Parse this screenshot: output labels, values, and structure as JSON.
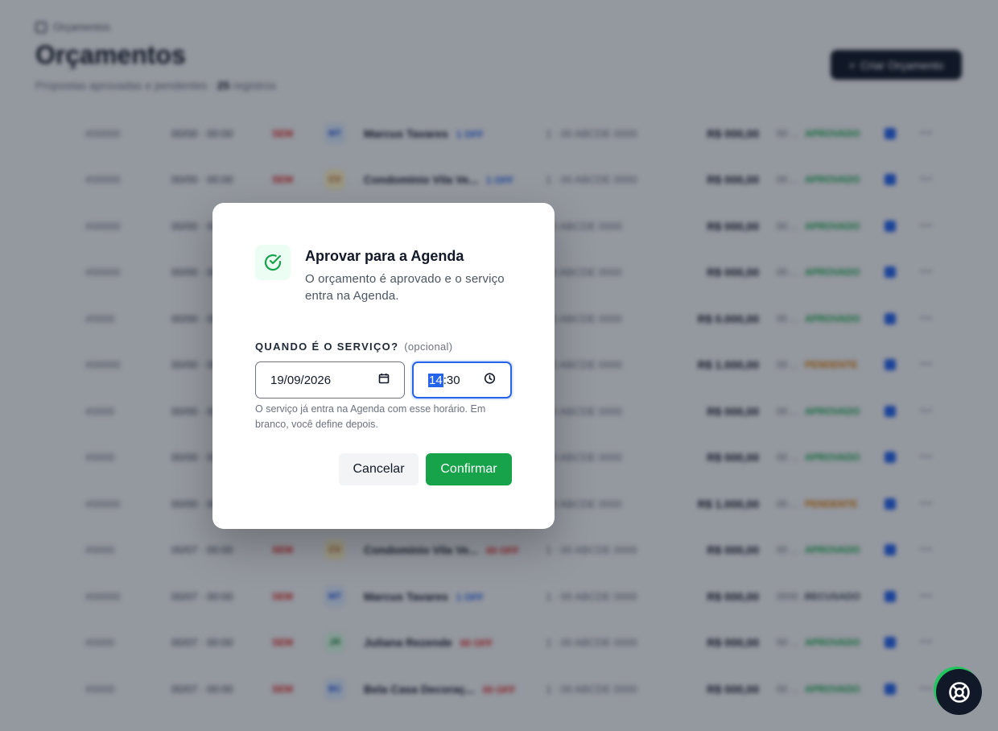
{
  "background": {
    "breadcrumb": "Orçamentos",
    "title": "Orçamentos",
    "subtitle": "Propostas aprovadas e pendentes",
    "subtitle_count": "25",
    "subtitle_suffix": "registros",
    "new_button": "Criar Orçamento"
  },
  "rows": [
    {
      "num": "#00000",
      "date": "00/00 · 00:00",
      "tag": "SEM",
      "av": "MT",
      "av_color": "#dbeafe",
      "av_text": "#1d4ed8",
      "client": "Marcus Tavares",
      "pill": "1 OFF",
      "pill_color": "#2563eb",
      "serv": "1 · 00 ABCDE 0000",
      "val": "R$ 000,00",
      "mini": "00 ...",
      "status": "APROVADO",
      "status_color": "#16a34a"
    },
    {
      "num": "#00000",
      "date": "00/00 · 00:00",
      "tag": "SEM",
      "av": "CV",
      "av_color": "#fef3c7",
      "av_text": "#b45309",
      "client": "Condomínio Vila Ve...",
      "pill": "1 OFF",
      "pill_color": "#2563eb",
      "serv": "1 · 00 ABCDE 0000",
      "val": "R$ 000,00",
      "mini": "00 ...",
      "status": "APROVADO",
      "status_color": "#16a34a"
    },
    {
      "num": "#00000",
      "date": "00/00 · 00:00",
      "tag": "",
      "av": "",
      "av_color": "transparent",
      "av_text": "#000",
      "client": "",
      "pill": "",
      "pill_color": "#000",
      "serv": "00 ABCDE 0000",
      "val": "R$ 000,00",
      "mini": "00 ...",
      "status": "APROVADO",
      "status_color": "#16a34a"
    },
    {
      "num": "#00000",
      "date": "00/00 · 00:00",
      "tag": "",
      "av": "",
      "av_color": "transparent",
      "av_text": "#000",
      "client": "",
      "pill": "",
      "pill_color": "#000",
      "serv": "00 ABCDE 0000",
      "val": "R$ 000,00",
      "mini": "00 ...",
      "status": "APROVADO",
      "status_color": "#16a34a"
    },
    {
      "num": "#0000",
      "date": "00/00 · 00:00",
      "tag": "",
      "av": "",
      "av_color": "transparent",
      "av_text": "#000",
      "client": "",
      "pill": "",
      "pill_color": "#000",
      "serv": "00 ABCDE 0000",
      "val": "R$ 0.000,00",
      "mini": "00 ...",
      "status": "APROVADO",
      "status_color": "#16a34a"
    },
    {
      "num": "#00000",
      "date": "00/00 · 00:00",
      "tag": "",
      "av": "",
      "av_color": "transparent",
      "av_text": "#000",
      "client": "",
      "pill": "",
      "pill_color": "#000",
      "serv": "00 ABCDE 0000",
      "val": "R$ 1.000,00",
      "mini": "00 ...",
      "status": "PENDENTE",
      "status_color": "#d97706"
    },
    {
      "num": "#0000",
      "date": "00/00 · 00:00",
      "tag": "",
      "av": "",
      "av_color": "transparent",
      "av_text": "#000",
      "client": "",
      "pill": "",
      "pill_color": "#000",
      "serv": "00 ABCDE 0000",
      "val": "R$ 000,00",
      "mini": "00 ...",
      "status": "APROVADO",
      "status_color": "#16a34a"
    },
    {
      "num": "#0000",
      "date": "00/00 · 00:00",
      "tag": "",
      "av": "",
      "av_color": "transparent",
      "av_text": "#000",
      "client": "",
      "pill": "",
      "pill_color": "#000",
      "serv": "00 ABCDE 0000",
      "val": "R$ 000,00",
      "mini": "00 ...",
      "status": "APROVADO",
      "status_color": "#16a34a"
    },
    {
      "num": "#00000",
      "date": "00/00 · 00:00",
      "tag": "",
      "av": "",
      "av_color": "transparent",
      "av_text": "#000",
      "client": "",
      "pill": "",
      "pill_color": "#000",
      "serv": "00 ABCDE 0000",
      "val": "R$ 1.000,00",
      "mini": "00 ...",
      "status": "PENDENTE",
      "status_color": "#d97706"
    },
    {
      "num": "#0000",
      "date": "00/07 · 00:00",
      "tag": "SEM",
      "av": "CV",
      "av_color": "#fef3c7",
      "av_text": "#b45309",
      "client": "Condomínio Vila Ve...",
      "pill": "00 OFF",
      "pill_color": "#dc2626",
      "serv": "1 · 00 ABCDE 0000",
      "val": "R$ 000,00",
      "mini": "00 ...",
      "status": "APROVADO",
      "status_color": "#16a34a"
    },
    {
      "num": "#00000",
      "date": "00/07 · 00:00",
      "tag": "SEM",
      "av": "MT",
      "av_color": "#dbeafe",
      "av_text": "#1d4ed8",
      "client": "Marcus Tavares",
      "pill": "1 OFF",
      "pill_color": "#2563eb",
      "serv": "1 · 00 ABCDE 0000",
      "val": "R$ 000,00",
      "mini": "0000 ...",
      "status": "RECUSADO",
      "status_color": "#374151"
    },
    {
      "num": "#0000",
      "date": "00/07 · 00:00",
      "tag": "SEM",
      "av": "JR",
      "av_color": "#dcfce7",
      "av_text": "#15803d",
      "client": "Juliana Rezende",
      "pill": "00 OFF",
      "pill_color": "#dc2626",
      "serv": "1 · 00 ABCDE 0000",
      "val": "R$ 000,00",
      "mini": "00 ...",
      "status": "APROVADO",
      "status_color": "#16a34a"
    },
    {
      "num": "#0000",
      "date": "00/07 · 00:00",
      "tag": "SEM",
      "av": "BC",
      "av_color": "#dbeafe",
      "av_text": "#1d4ed8",
      "client": "Bela Casa Decoraç...",
      "pill": "00 OFF",
      "pill_color": "#dc2626",
      "serv": "1 · 00 ABCDE 0000",
      "val": "R$ 000,00",
      "mini": "00 ...",
      "status": "APROVADO",
      "status_color": "#16a34a"
    }
  ],
  "modal": {
    "title": "Aprovar para a Agenda",
    "description": "O orçamento é aprovado e o serviço entra na Agenda.",
    "label": "QUANDO É O SERVIÇO?",
    "label_optional": "(opcional)",
    "date_value": "19/09/2026",
    "time_hour": "14",
    "time_sep": ":",
    "time_minute": "30",
    "help": "O serviço já entra na Agenda com esse horário. Em branco, você define depois.",
    "cancel_label": "Cancelar",
    "confirm_label": "Confirmar",
    "accent_color": "#16a34a",
    "focus_color": "#2563eb"
  }
}
